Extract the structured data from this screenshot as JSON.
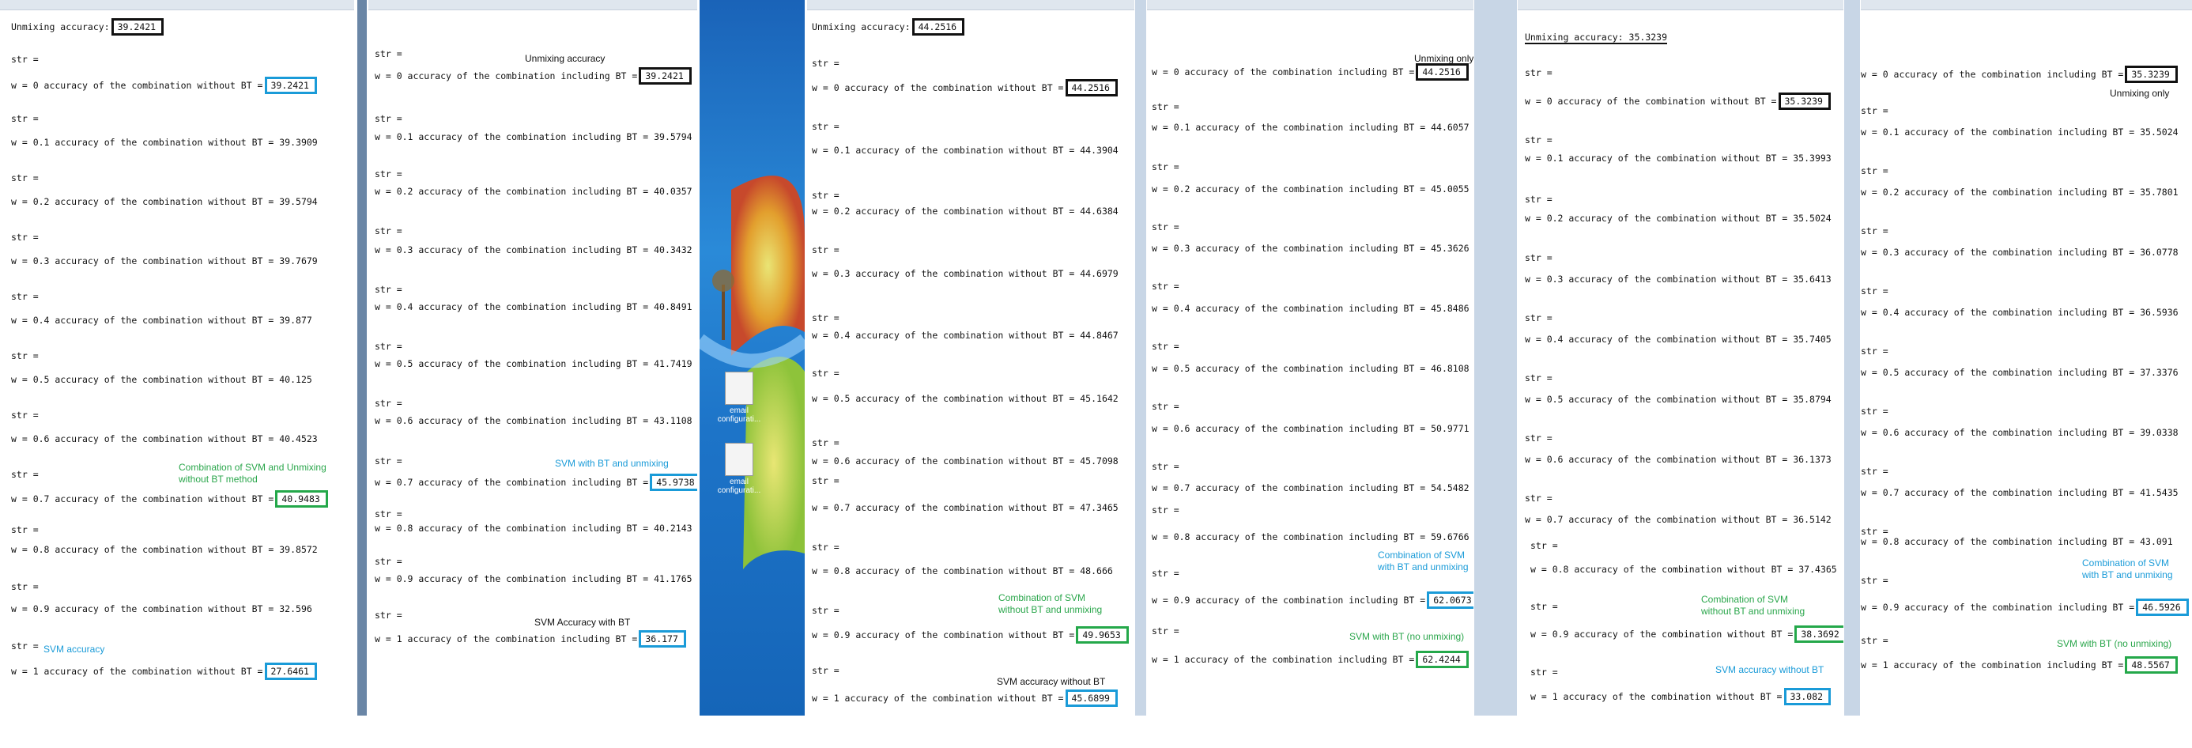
{
  "windows": [
    {
      "id": "p1",
      "header": {
        "label": "Unmixing accuracy:",
        "value": "39.2421"
      },
      "rows": [
        {
          "str": "str =",
          "text": "w = 0 accuracy of the combination without BT =",
          "value": "39.2421"
        },
        {
          "str": "str =",
          "text": "w = 0.1 accuracy of the combination without BT = 39.3909",
          "value": ""
        },
        {
          "str": "str =",
          "text": "w = 0.2 accuracy of the combination without BT = 39.5794",
          "value": ""
        },
        {
          "str": "str =",
          "text": "w = 0.3 accuracy of the combination without BT = 39.7679",
          "value": ""
        },
        {
          "str": "str =",
          "text": "w = 0.4 accuracy of the combination without BT = 39.877",
          "value": ""
        },
        {
          "str": "str =",
          "text": "w = 0.5 accuracy of the combination without BT = 40.125",
          "value": ""
        },
        {
          "str": "str =",
          "text": "w = 0.6 accuracy of the combination without BT = 40.4523",
          "value": ""
        },
        {
          "str": "str =",
          "text": "w = 0.7 accuracy of the combination without BT =",
          "value": "40.9483"
        },
        {
          "str": "str =",
          "text": "w = 0.8 accuracy of the combination without BT = 39.8572",
          "value": ""
        },
        {
          "str": "str =",
          "text": "w = 0.9 accuracy of the combination without BT = 32.596",
          "value": ""
        },
        {
          "str": "str =",
          "text": "w = 1 accuracy of the combination without BT =",
          "value": "27.6461"
        }
      ],
      "notes": [
        "Combination of SVM and Unmixing",
        "without BT method",
        "SVM accuracy"
      ]
    },
    {
      "id": "p2",
      "rows": [
        {
          "str": "str =",
          "text": "w = 0 accuracy of the combination including BT =",
          "value": "39.2421"
        },
        {
          "str": "str =",
          "text": "w = 0.1 accuracy of the combination including BT = 39.5794",
          "value": ""
        },
        {
          "str": "str =",
          "text": "w = 0.2 accuracy of the combination including BT = 40.0357",
          "value": ""
        },
        {
          "str": "str =",
          "text": "w = 0.3 accuracy of the combination including BT = 40.3432",
          "value": ""
        },
        {
          "str": "str =",
          "text": "w = 0.4 accuracy of the combination including BT = 40.8491",
          "value": ""
        },
        {
          "str": "str =",
          "text": "w = 0.5 accuracy of the combination including BT = 41.7419",
          "value": ""
        },
        {
          "str": "str =",
          "text": "w = 0.6 accuracy of the combination including BT = 43.1108",
          "value": ""
        },
        {
          "str": "str =",
          "text": "w = 0.7 accuracy of the combination including BT =",
          "value": "45.9738"
        },
        {
          "str": "str =",
          "text": "w = 0.8 accuracy of the combination including BT = 40.2143",
          "value": ""
        },
        {
          "str": "str =",
          "text": "w = 0.9 accuracy of the combination including BT = 41.1765",
          "value": ""
        },
        {
          "str": "str =",
          "text": "w = 1 accuracy of the combination including BT =",
          "value": "36.177"
        }
      ],
      "notes": [
        "Unmixing accuracy",
        "SVM with BT and unmixing",
        "SVM Accuracy  with BT"
      ]
    },
    {
      "id": "p3",
      "header": {
        "label": "Unmixing accuracy:",
        "value": "44.2516"
      },
      "rows": [
        {
          "str": "str =",
          "text": "w = 0 accuracy of the combination without BT =",
          "value": "44.2516"
        },
        {
          "str": "str =",
          "text": "w = 0.1 accuracy of the combination without BT = 44.3904",
          "value": ""
        },
        {
          "str": "str =",
          "text": "w = 0.2 accuracy of the combination without BT = 44.6384",
          "value": ""
        },
        {
          "str": "str =",
          "text": "w = 0.3 accuracy of the combination without BT = 44.6979",
          "value": ""
        },
        {
          "str": "str =",
          "text": "w = 0.4 accuracy of the combination without BT = 44.8467",
          "value": ""
        },
        {
          "str": "str =",
          "text": "w = 0.5 accuracy of the combination without BT = 45.1642",
          "value": ""
        },
        {
          "str": "str =",
          "text": "w = 0.6 accuracy of the combination without BT = 45.7098",
          "value": ""
        },
        {
          "str": "str =",
          "text": "w = 0.7 accuracy of the combination without BT = 47.3465",
          "value": ""
        },
        {
          "str": "str =",
          "text": "w = 0.8 accuracy of the combination without BT = 48.666",
          "value": ""
        },
        {
          "str": "str =",
          "text": "w = 0.9 accuracy of the combination without BT =",
          "value": "49.9653"
        },
        {
          "str": "str =",
          "text": "w = 1 accuracy of the combination without BT =",
          "value": "45.6899"
        }
      ],
      "notes": [
        "Combination of SVM",
        "without BT and unmixing",
        "SVM accuracy without BT"
      ]
    },
    {
      "id": "p4",
      "rows": [
        {
          "str": "",
          "text": "w = 0 accuracy of the combination including BT =",
          "value": "44.2516"
        },
        {
          "str": "str =",
          "text": "w = 0.1 accuracy of the combination including BT = 44.6057",
          "value": ""
        },
        {
          "str": "str =",
          "text": "w = 0.2 accuracy of the combination including BT = 45.0055",
          "value": ""
        },
        {
          "str": "str =",
          "text": "w = 0.3 accuracy of the combination including BT = 45.3626",
          "value": ""
        },
        {
          "str": "str =",
          "text": "w = 0.4 accuracy of the combination including BT = 45.8486",
          "value": ""
        },
        {
          "str": "str =",
          "text": "w = 0.5 accuracy of the combination including BT = 46.8108",
          "value": ""
        },
        {
          "str": "str =",
          "text": "w = 0.6 accuracy of the combination including BT = 50.9771",
          "value": ""
        },
        {
          "str": "str =",
          "text": "w = 0.7 accuracy of the combination including BT = 54.5482",
          "value": ""
        },
        {
          "str": "str =",
          "text": "w = 0.8 accuracy of the combination including BT = 59.6766",
          "value": ""
        },
        {
          "str": "str =",
          "text": "w = 0.9 accuracy of the combination including BT =",
          "value": "62.0673"
        },
        {
          "str": "str =",
          "text": "w = 1 accuracy of the combination including BT =",
          "value": "62.4244"
        }
      ],
      "notes": [
        "Unmixing only",
        "Combination of SVM",
        "with BT and unmixing",
        "SVM with BT (no unmixing)"
      ]
    },
    {
      "id": "p5",
      "header": {
        "label": "Unmixing accuracy: 35.3239",
        "value": ""
      },
      "rows": [
        {
          "str": "str =",
          "text": "w = 0 accuracy of the combination without BT =",
          "value": "35.3239"
        },
        {
          "str": "str =",
          "text": "w = 0.1 accuracy of the combination without BT = 35.3993",
          "value": ""
        },
        {
          "str": "str =",
          "text": "w = 0.2 accuracy of the combination without BT = 35.5024",
          "value": ""
        },
        {
          "str": "str =",
          "text": "w = 0.3 accuracy of the combination without BT = 35.6413",
          "value": ""
        },
        {
          "str": "str =",
          "text": "w = 0.4 accuracy of the combination without BT = 35.7405",
          "value": ""
        },
        {
          "str": "str =",
          "text": "w = 0.5 accuracy of the combination without BT = 35.8794",
          "value": ""
        },
        {
          "str": "str =",
          "text": "w = 0.6 accuracy of the combination without BT = 36.1373",
          "value": ""
        },
        {
          "str": "str =",
          "text": "w = 0.7 accuracy of the combination without BT = 36.5142",
          "value": ""
        },
        {
          "str": "str =",
          "text": "w = 0.8 accuracy of the combination without BT = 37.4365",
          "value": ""
        },
        {
          "str": "str =",
          "text": "w = 0.9 accuracy of the combination without BT =",
          "value": "38.3692"
        },
        {
          "str": "str =",
          "text": "w = 1 accuracy of the combination without BT =",
          "value": "33.082"
        }
      ],
      "notes": [
        "Combination of SVM",
        "without BT and unmixing",
        "SVM accuracy without BT"
      ]
    },
    {
      "id": "p6",
      "rows": [
        {
          "str": "",
          "text": "w = 0 accuracy of the combination including BT =",
          "value": "35.3239"
        },
        {
          "str": "str =",
          "text": "w = 0.1 accuracy of the combination including BT = 35.5024",
          "value": ""
        },
        {
          "str": "str =",
          "text": "w = 0.2 accuracy of the combination including BT = 35.7801",
          "value": ""
        },
        {
          "str": "str =",
          "text": "w = 0.3 accuracy of the combination including BT = 36.0778",
          "value": ""
        },
        {
          "str": "str =",
          "text": "w = 0.4 accuracy of the combination including BT = 36.5936",
          "value": ""
        },
        {
          "str": "str =",
          "text": "w = 0.5 accuracy of the combination including BT = 37.3376",
          "value": ""
        },
        {
          "str": "str =",
          "text": "w = 0.6 accuracy of the combination including BT = 39.0338",
          "value": ""
        },
        {
          "str": "str =",
          "text": "w = 0.7 accuracy of the combination including BT = 41.5435",
          "value": ""
        },
        {
          "str": "str =",
          "text": "w = 0.8 accuracy of the combination including BT = 43.091",
          "value": ""
        },
        {
          "str": "str =",
          "text": "w = 0.9 accuracy of the combination including BT =",
          "value": "46.5926"
        },
        {
          "str": "str =",
          "text": "w = 1 accuracy of the combination including BT =",
          "value": "48.5567"
        }
      ],
      "notes": [
        "Unmixing only",
        "Combination of SVM",
        "with BT and unmixing",
        "SVM with BT (no unmixing)"
      ]
    }
  ],
  "desktop": {
    "icons": [
      "email configurati...",
      "email configurati..."
    ]
  },
  "colors": {
    "black": "#111111",
    "blue": "#1a9bd8",
    "green": "#24a84a"
  }
}
